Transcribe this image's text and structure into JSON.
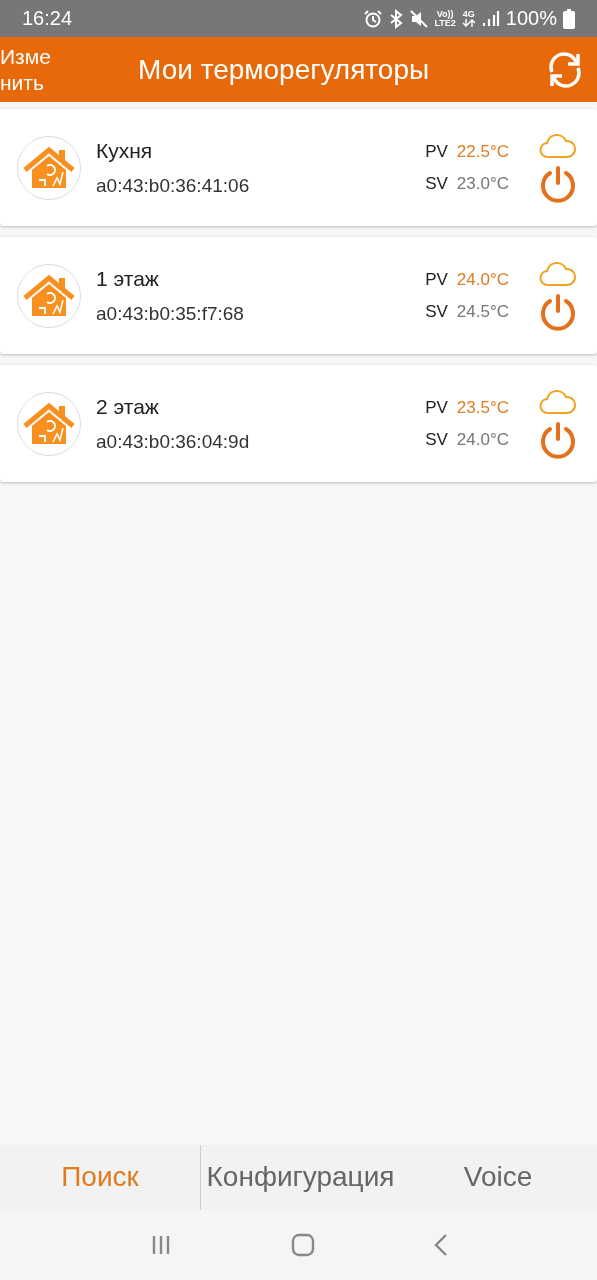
{
  "status_bar": {
    "time": "16:24",
    "network_labels": [
      "Vo))",
      "LTE2",
      "4G"
    ],
    "battery": "100%"
  },
  "header": {
    "edit_button": "Изменить",
    "title": "Мои терморегуляторы"
  },
  "devices": [
    {
      "name": "Кухня",
      "mac": "a0:43:b0:36:41:06",
      "pv_label": "PV",
      "pv": "22.5°C",
      "sv_label": "SV",
      "sv": "23.0°C"
    },
    {
      "name": "1 этаж",
      "mac": "a0:43:b0:35:f7:68",
      "pv_label": "PV",
      "pv": "24.0°C",
      "sv_label": "SV",
      "sv": "24.5°C"
    },
    {
      "name": "2 этаж",
      "mac": "a0:43:b0:36:04:9d",
      "pv_label": "PV",
      "pv": "23.5°C",
      "sv_label": "SV",
      "sv": "24.0°C"
    }
  ],
  "tabs": [
    {
      "label": "Поиск",
      "selected": true
    },
    {
      "label": "Конфигурация",
      "selected": false
    },
    {
      "label": "Voice",
      "selected": false
    }
  ]
}
